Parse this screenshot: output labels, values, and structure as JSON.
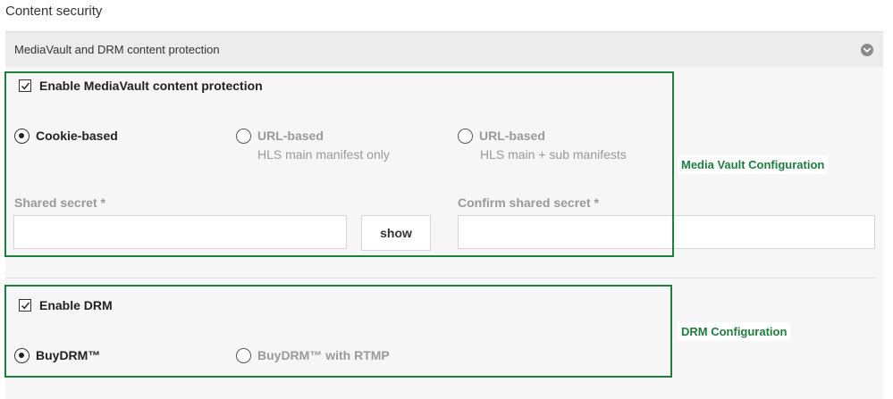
{
  "page_title": "Content security",
  "panel": {
    "title": "MediaVault and DRM content protection",
    "toggle_icon": "chevron-down-circle-icon"
  },
  "mediavault": {
    "enable_label": "Enable MediaVault content protection",
    "enabled": true,
    "options": [
      {
        "label": "Cookie-based",
        "sublabel": "",
        "selected": true
      },
      {
        "label": "URL-based",
        "sublabel": "HLS main manifest only",
        "selected": false
      },
      {
        "label": "URL-based",
        "sublabel": "HLS main + sub manifests",
        "selected": false
      }
    ],
    "shared_secret_label": "Shared secret *",
    "shared_secret_value": "",
    "show_button_label": "show",
    "confirm_secret_label": "Confirm shared secret *",
    "confirm_secret_value": "",
    "annotation": "Media Vault Configuration"
  },
  "drm": {
    "enable_label": "Enable DRM",
    "enabled": true,
    "options": [
      {
        "label": "BuyDRM™",
        "selected": true
      },
      {
        "label": "BuyDRM™ with RTMP",
        "selected": false
      }
    ],
    "annotation": "DRM Configuration"
  },
  "colors": {
    "annotation_green": "#1e7e3e",
    "header_bg": "#ececec",
    "body_bg": "#f6f6f6",
    "disabled_text": "#999999"
  }
}
